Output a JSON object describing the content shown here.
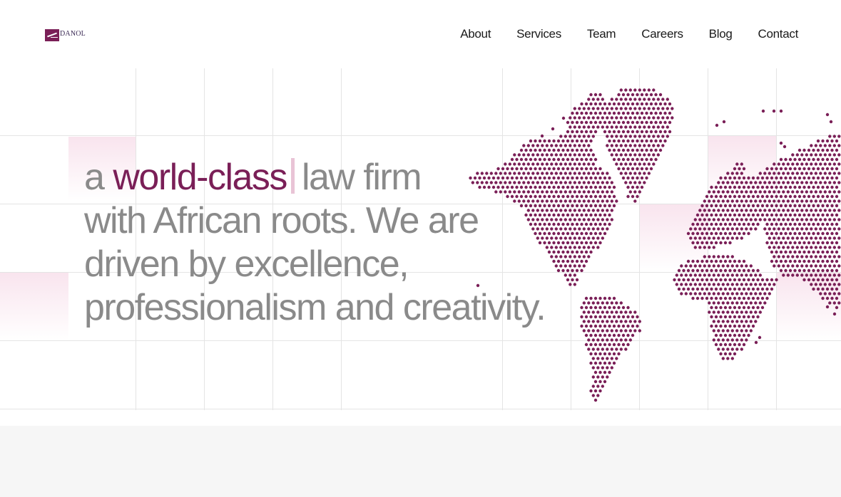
{
  "logo": {
    "text": "DANOL"
  },
  "nav": {
    "items": [
      "About",
      "Services",
      "Team",
      "Careers",
      "Blog",
      "Contact"
    ]
  },
  "hero": {
    "prefix": "a ",
    "highlight": "world-class",
    "line1_rest": "law firm",
    "line2": "with African roots. We are",
    "line3": "driven by excellence,",
    "line4": "professionalism and creativity."
  },
  "colors": {
    "accent": "#7a1f57",
    "text_gray": "#8a8a8a",
    "cursor": "#e9c4d6"
  },
  "icons": {
    "logo": "danol-logo",
    "map": "world-dot-map"
  }
}
